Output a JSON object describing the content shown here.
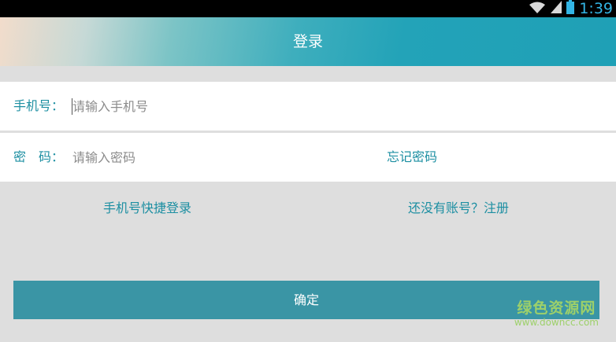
{
  "status_bar": {
    "time": "1:39",
    "icons": [
      "wifi-icon",
      "signal-icon",
      "battery-icon"
    ]
  },
  "header": {
    "title": "登录"
  },
  "form": {
    "phone": {
      "label": "手机号：",
      "placeholder": "请输入手机号",
      "value": ""
    },
    "password": {
      "label": "密　码：",
      "placeholder": "请输入密码",
      "value": ""
    },
    "forgot_password_label": "忘记密码"
  },
  "links": {
    "quick_login_label": "手机号快捷登录",
    "register_label": "还没有账号？注册"
  },
  "confirm_label": "确定",
  "watermark": {
    "text": "绿色资源网",
    "url": "www.downcc.com"
  },
  "colors": {
    "accent": "#1d8fa2",
    "button": "#3a95a5",
    "background": "#dedede",
    "status_time": "#33b5e5"
  }
}
